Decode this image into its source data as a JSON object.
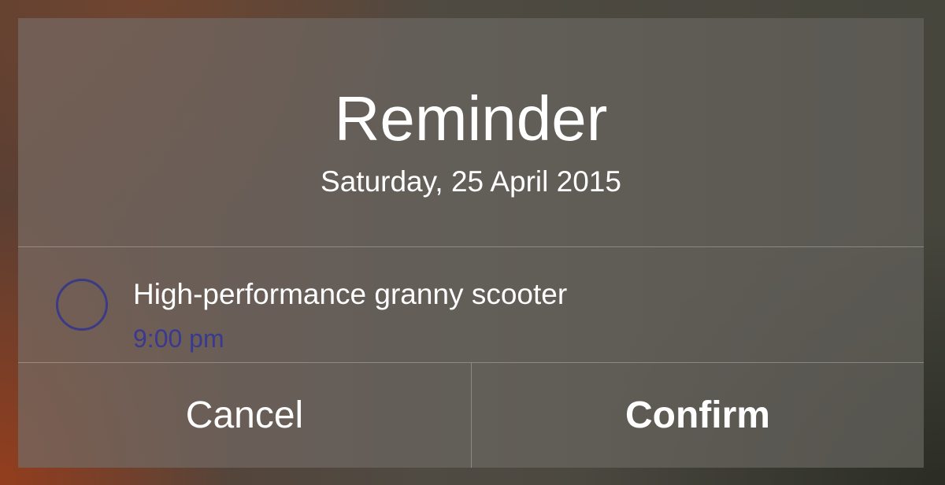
{
  "alert": {
    "title": "Reminder",
    "date": "Saturday, 25 April 2015"
  },
  "reminder": {
    "title": "High-performance granny scooter",
    "time": "9:00 pm",
    "checkbox_icon": "circle-outline-icon",
    "completed": false
  },
  "actions": {
    "cancel_label": "Cancel",
    "confirm_label": "Confirm"
  },
  "colors": {
    "accent": "#3a3990",
    "text": "#ffffff"
  }
}
